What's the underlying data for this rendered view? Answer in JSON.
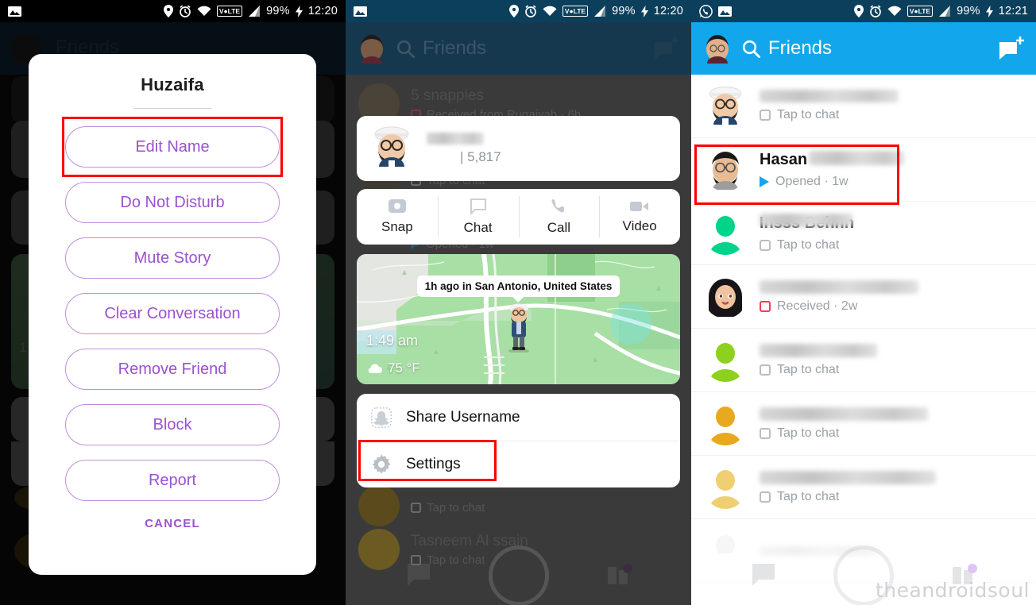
{
  "panels": [
    {
      "id": "panel-profile-actions",
      "status_bar": {
        "time": "12:20",
        "battery": "99%",
        "network": "VoLTE",
        "icons": [
          "image-icon",
          "location-pin-icon",
          "alarm-clock-icon",
          "wifi-icon",
          "volte-icon",
          "signal-bars-icon",
          "charging-bolt-icon"
        ]
      },
      "header": {
        "title": "Friends",
        "search_icon": "search-icon",
        "new_chat_icon": "new-chat-icon",
        "avatar": "bitmoji-avatar"
      },
      "dialog": {
        "title": "Huzaifa",
        "options": [
          {
            "label": "Edit Name",
            "highlighted": true
          },
          {
            "label": "Do Not Disturb",
            "highlighted": false
          },
          {
            "label": "Mute Story",
            "highlighted": false
          },
          {
            "label": "Clear Conversation",
            "highlighted": false
          },
          {
            "label": "Remove Friend",
            "highlighted": false
          },
          {
            "label": "Block",
            "highlighted": false
          },
          {
            "label": "Report",
            "highlighted": false
          }
        ],
        "cancel_label": "CANCEL"
      }
    },
    {
      "id": "panel-friend-profile",
      "status_bar": {
        "time": "12:20",
        "battery": "99%",
        "network": "VoLTE"
      },
      "header": {
        "title": "Friends"
      },
      "background_list": [
        {
          "name": "5 snappies",
          "sub": "Received from Rugaiyah  ·  6h",
          "state": "received"
        },
        {
          "name": "",
          "sub": "Tap to chat",
          "state": "tap"
        },
        {
          "name": "",
          "sub": "Opened · 1w",
          "state": "opened"
        },
        {
          "name": "",
          "sub": "Tap to chat",
          "state": "tap"
        },
        {
          "name": "Tasneem Al       ssain",
          "sub": "Tap to chat",
          "state": "tap"
        }
      ],
      "profile_card": {
        "name_blurred": true,
        "score": "5,817",
        "score_divider": "|"
      },
      "actions": [
        {
          "label": "Snap",
          "icon": "camera-icon"
        },
        {
          "label": "Chat",
          "icon": "chat-bubble-icon"
        },
        {
          "label": "Call",
          "icon": "phone-icon"
        },
        {
          "label": "Video",
          "icon": "video-camera-icon"
        }
      ],
      "map": {
        "bubble": "1h ago in San Antonio, United States",
        "time": "1:49 am",
        "temperature": "75 °F",
        "weather_icon": "cloud-icon"
      },
      "options": [
        {
          "label": "Share Username",
          "icon": "snapchat-ghost-icon",
          "highlighted": false
        },
        {
          "label": "Settings",
          "icon": "gear-icon",
          "highlighted": true
        }
      ]
    },
    {
      "id": "panel-friends-list",
      "status_bar": {
        "time": "12:21",
        "battery": "99%",
        "network": "VoLTE",
        "icons": [
          "whatsapp-icon",
          "image-icon",
          "location-pin-icon",
          "alarm-clock-icon",
          "wifi-icon",
          "volte-icon",
          "signal-bars-icon",
          "charging-bolt-icon"
        ]
      },
      "header": {
        "title": "Friends",
        "search_icon": "search-icon",
        "new_chat_icon": "new-chat-icon",
        "avatar": "bitmoji-avatar"
      },
      "rows": [
        {
          "name": "",
          "name_blurred": true,
          "status": "Tap to chat",
          "status_icon": "chat-square-icon",
          "avatar": "bitmoji-cap-glasses",
          "highlighted": true
        },
        {
          "name": "Hasan",
          "name_blurred": true,
          "status": "Opened · 1w",
          "status_icon": "opened-arrow-icon",
          "avatar": "bitmoji-grey-shirt",
          "highlighted": false
        },
        {
          "name": "Insss Behnn",
          "name_blurred": true,
          "status": "Tap to chat",
          "status_icon": "chat-square-icon",
          "avatar": "silhouette-teal",
          "highlighted": false
        },
        {
          "name": "",
          "name_blurred": true,
          "status": "Received · 2w",
          "status_icon": "received-square-icon",
          "avatar": "bitmoji-long-hair",
          "highlighted": false
        },
        {
          "name": "",
          "name_blurred": true,
          "status": "Tap to chat",
          "status_icon": "chat-square-icon",
          "avatar": "silhouette-green",
          "highlighted": false
        },
        {
          "name": "",
          "name_blurred": true,
          "status": "Tap to chat",
          "status_icon": "chat-square-icon",
          "avatar": "silhouette-orange",
          "highlighted": false
        },
        {
          "name": "",
          "name_blurred": true,
          "status": "Tap to chat",
          "status_icon": "chat-square-icon",
          "avatar": "silhouette-yellow",
          "highlighted": false
        }
      ],
      "watermark": "theandroidsoul"
    }
  ],
  "colors": {
    "snapchat_blue": "#12a6ec",
    "dialog_purple": "#9b51d0",
    "highlight_red": "#ff0000",
    "status_bar_dark": "#000000",
    "status_bar_blue": "#0c3f5c"
  }
}
